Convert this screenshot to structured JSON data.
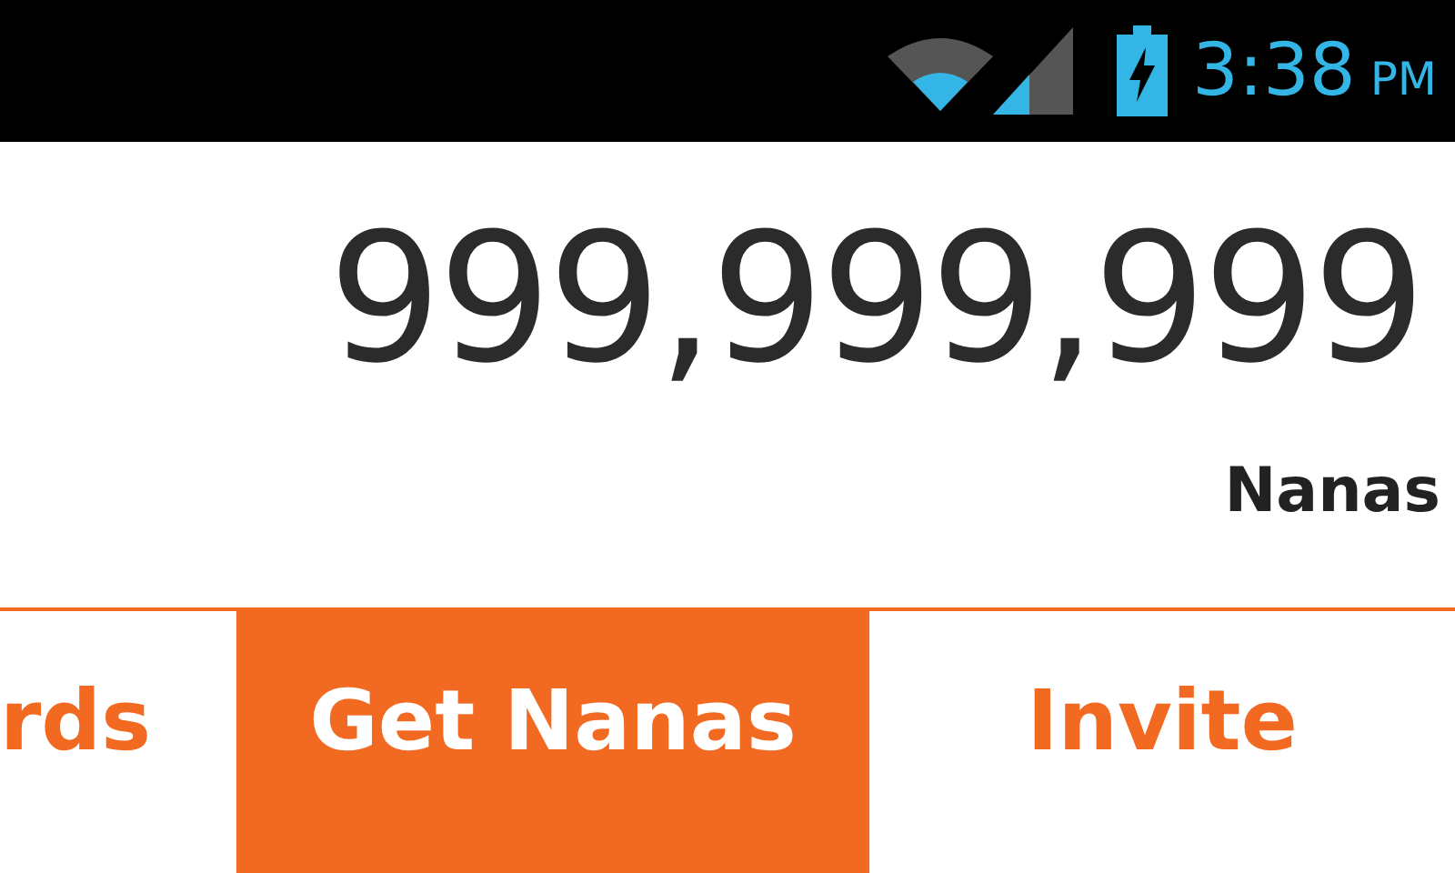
{
  "status_bar": {
    "time": "3:38",
    "meridiem": "PM"
  },
  "balance": {
    "amount": "999,999,999",
    "unit": "Nanas"
  },
  "tabs": [
    {
      "label": "rds",
      "selected": false
    },
    {
      "label": "Get Nanas",
      "selected": true
    },
    {
      "label": "Invite",
      "selected": false
    }
  ]
}
